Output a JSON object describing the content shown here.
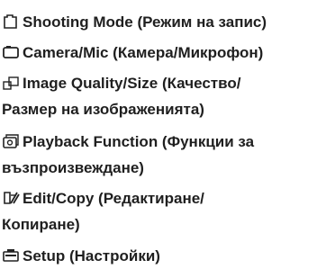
{
  "menu": {
    "items": [
      {
        "icon": "shooting-mode-icon",
        "label": "Shooting Mode (Режим на запис)"
      },
      {
        "icon": "camera-mic-icon",
        "label": "Camera/Mic (Камера/Микрофон)"
      },
      {
        "icon": "image-quality-icon",
        "label_line1": "Image Quality/Size (Качество/",
        "label_line2": "Размер на изображенията)"
      },
      {
        "icon": "playback-icon",
        "label_line1": "Playback Function (Функции за",
        "label_line2": "възпроизвеждане)"
      },
      {
        "icon": "edit-copy-icon",
        "label_line1": "Edit/Copy (Редактиране/",
        "label_line2": "Копиране)"
      },
      {
        "icon": "setup-icon",
        "label": "Setup (Настройки)"
      }
    ]
  }
}
